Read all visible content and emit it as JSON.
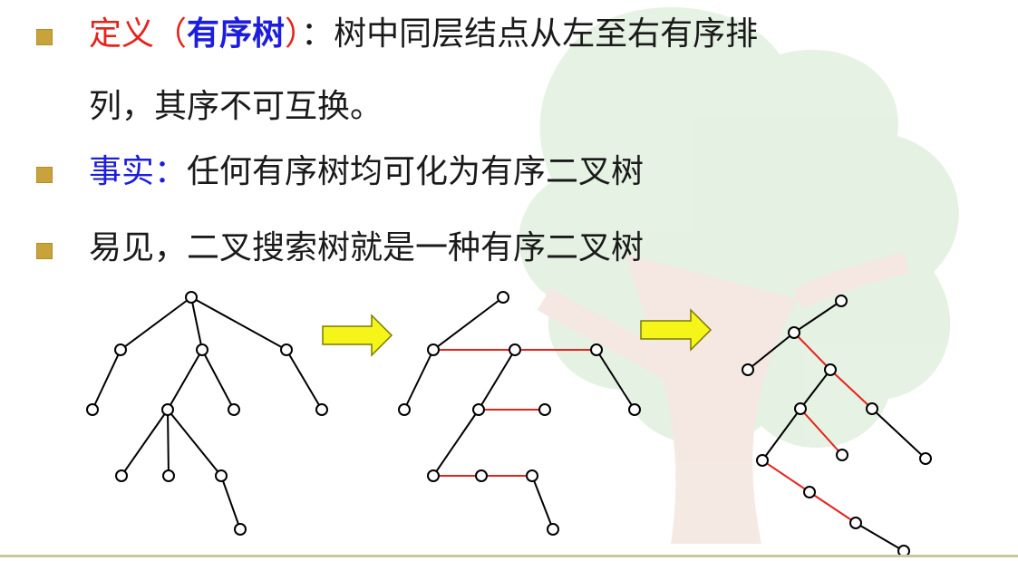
{
  "bullets": [
    {
      "label": "定义",
      "open_paren": "（",
      "term": "有序树",
      "close_paren": "）",
      "colon": "：",
      "text_line1": "树中同层结点从左至右有序排",
      "text_line2": "列，其序不可互换。"
    },
    {
      "label": "事实",
      "colon": "：",
      "text": "任何有序树均可化为有序二叉树"
    },
    {
      "text": "易见，二叉搜索树就是一种有序二叉树"
    }
  ],
  "colors": {
    "definition": "#e5231b",
    "term": "#1d1de0",
    "fact": "#1d1de0",
    "added_edge": "#e5231b",
    "arrow_fill": "#f5f51a",
    "bullet": "#c8a23a"
  }
}
